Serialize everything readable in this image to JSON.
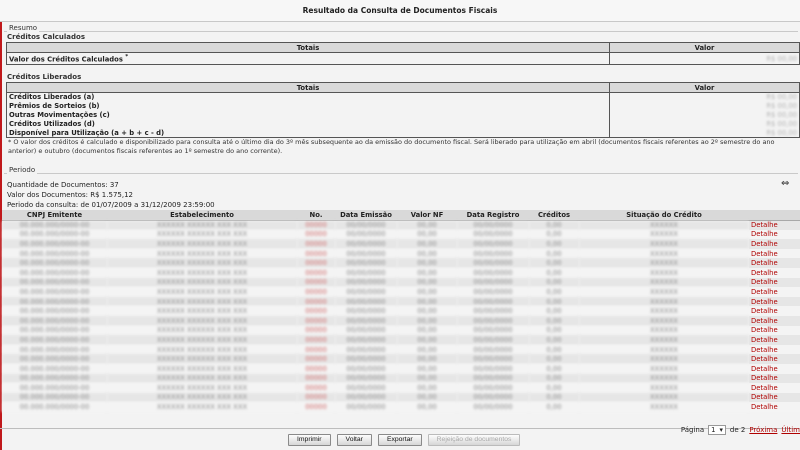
{
  "title": "Resultado da Consulta de Documentos Fiscais",
  "resumo": {
    "legend": "Resumo",
    "creditos_calculados": {
      "heading": "Créditos Calculados",
      "col_totais": "Totais",
      "col_valor": "Valor",
      "row_label": "Valor dos Créditos Calculados",
      "row_mark": "*"
    },
    "creditos_liberados": {
      "heading": "Créditos Liberados",
      "col_totais": "Totais",
      "col_valor": "Valor",
      "rows": [
        "Créditos Liberados (a)",
        "Prêmios de Sorteios (b)",
        "Outras Movimentações (c)",
        "Créditos Utilizados (d)",
        "Disponível para Utilização (a + b + c - d)"
      ]
    },
    "note": "* O valor dos créditos é calculado e disponibilizado para consulta até o último dia do 3º mês subsequente ao da emissão do documento fiscal. Será liberado para utilização em abril (documentos fiscais referentes ao 2º semestre do ano anterior) e outubro (documentos fiscais referentes ao 1º semestre do ano corrente)."
  },
  "periodo": {
    "legend": "Periodo",
    "qtd_label": "Quantidade de Documentos:",
    "qtd_value": "37",
    "valor_label": "Valor dos Documentos:",
    "valor_value": "R$ 1.575,12",
    "consulta_label": "Periodo da consulta:",
    "consulta_value": "de 01/07/2009 a 31/12/2009 23:59:00"
  },
  "table": {
    "headers": [
      "CNPJ Emitente",
      "Estabelecimento",
      "No.",
      "Data Emissão",
      "Valor NF",
      "Data Registro",
      "Créditos",
      "Situação do Crédito",
      ""
    ],
    "row_count": 20,
    "link_label": "Detalhe"
  },
  "pager": {
    "page_label": "Página",
    "current": "1",
    "of_label": "de 2",
    "next": "Próxima",
    "last": "Últim"
  },
  "buttons": {
    "imprimir": "Imprimir",
    "voltar": "Voltar",
    "exportar": "Exportar",
    "rejeicao": "Rejeição de documentos"
  },
  "colors": {
    "accent": "#c0181b",
    "link": "#b00000",
    "header_bg": "#d9d9d9"
  }
}
